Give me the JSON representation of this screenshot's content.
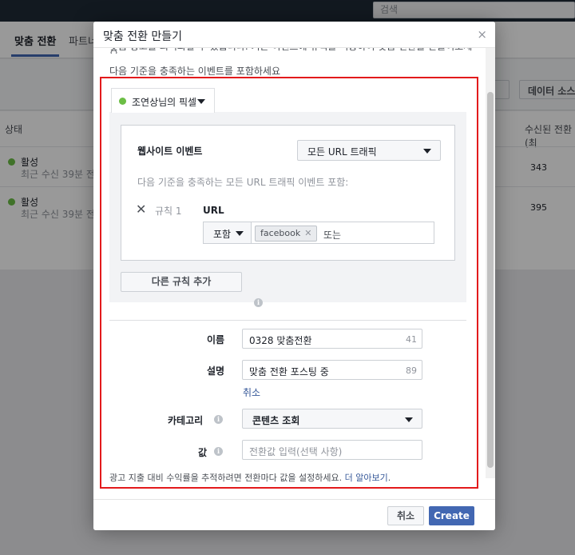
{
  "background": {
    "search_placeholder": "검색",
    "tabs": [
      "맞춤 전환",
      "파트너"
    ],
    "toolbar_button": "데이터 소스",
    "table_headers": [
      "상태",
      "수신된 전환(최"
    ],
    "rows": [
      {
        "status": "활성",
        "sub": "최근 수신 39분 전",
        "value": "343"
      },
      {
        "status": "활성",
        "sub": "최근 수신 39분 전",
        "value": "395"
      }
    ]
  },
  "modal": {
    "title": "맞춤 전환 만들기",
    "close_symbol": "×",
    "intro_cutoff": "맞춤 광고를 최적화할 수 있습니다. 기존 이벤트에 규칙을 적용하여 맞춤 전환을 만들어보세요.",
    "intro": "다음 기준을 충족하는 이벤트를 포함하세요",
    "pixel_name": "조연상님의 픽셀",
    "rule": {
      "website_event_label": "웹사이트 이벤트",
      "website_event_value": "모든 URL 트래픽",
      "description": "다음 기준을 충족하는 모든 URL 트래픽 이벤트 포함:",
      "remove_symbol": "✕",
      "rule_number": "규칙 1",
      "field_label": "URL",
      "operator": "포함",
      "token": "facebook",
      "token_remove": "✕",
      "or_text": "또는"
    },
    "add_rule_button": "다른 규칙 추가",
    "form": {
      "name_label": "이름",
      "name_value": "0328 맞춤전환",
      "name_count": "41",
      "desc_label": "설명",
      "desc_value": "맞춤 전환 포스팅 중",
      "desc_count": "89",
      "cancel_link": "취소",
      "category_label": "카테고리",
      "category_value": "콘텐츠 조회",
      "value_label": "값",
      "value_placeholder": "전환값 입력(선택 사항)"
    },
    "footer_note": "광고 지출 대비 수익률을 추적하려면 전환마다 값을 설정하세요.",
    "learn_more": "더 알아보기",
    "buttons": {
      "cancel": "취소",
      "create": "Create"
    }
  }
}
